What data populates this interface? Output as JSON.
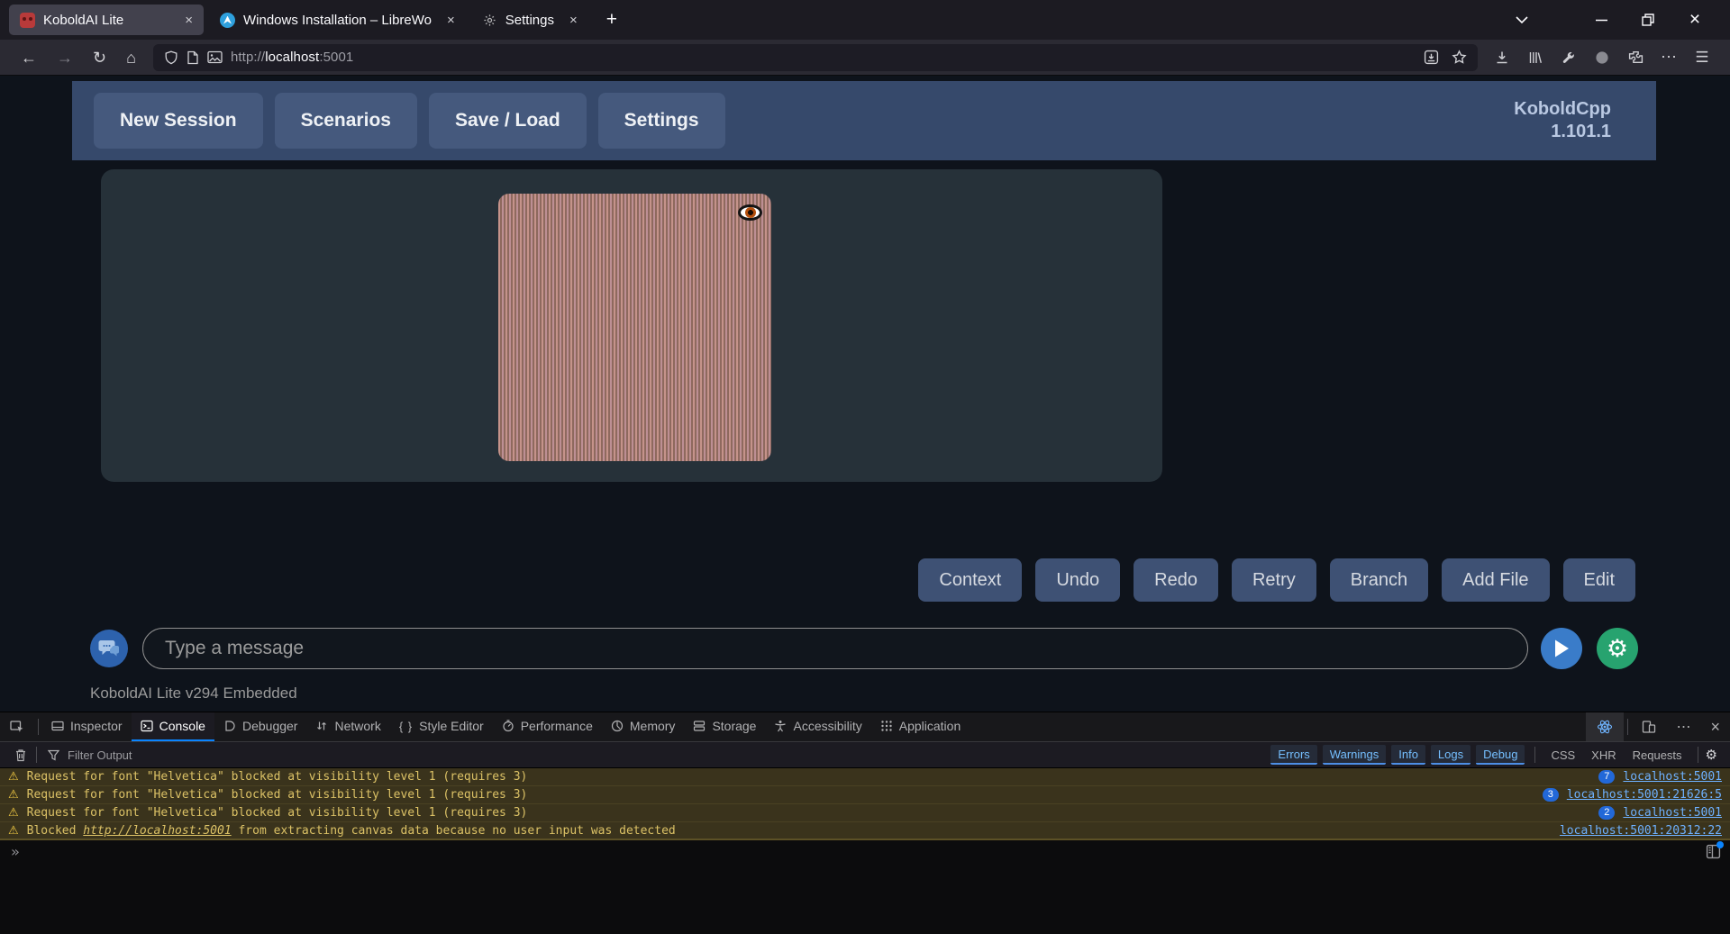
{
  "browser": {
    "tabs": [
      {
        "title": "KoboldAI Lite"
      },
      {
        "title": "Windows Installation – LibreWo"
      },
      {
        "title": "Settings"
      }
    ],
    "url": {
      "scheme": "http://",
      "host": "localhost",
      "port": ":5001"
    }
  },
  "app": {
    "nav": {
      "new_session": "New Session",
      "scenarios": "Scenarios",
      "save_load": "Save / Load",
      "settings": "Settings"
    },
    "brand": {
      "line1": "KoboldCpp",
      "line2": "1.101.1"
    },
    "actions": {
      "context": "Context",
      "undo": "Undo",
      "redo": "Redo",
      "retry": "Retry",
      "branch": "Branch",
      "add_file": "Add File",
      "edit": "Edit"
    },
    "chat": {
      "placeholder": "Type a message"
    },
    "footer": "KoboldAI Lite v294 Embedded"
  },
  "devtools": {
    "tabs": {
      "inspector": "Inspector",
      "console": "Console",
      "debugger": "Debugger",
      "network": "Network",
      "style_editor": "Style Editor",
      "performance": "Performance",
      "memory": "Memory",
      "storage": "Storage",
      "accessibility": "Accessibility",
      "application": "Application"
    },
    "active_tab": "Console",
    "filter": {
      "placeholder": "Filter Output",
      "errors": "Errors",
      "warnings": "Warnings",
      "info": "Info",
      "logs": "Logs",
      "debug": "Debug",
      "css": "CSS",
      "xhr": "XHR",
      "requests": "Requests"
    },
    "messages": [
      {
        "text": "Request for font \"Helvetica\" blocked at visibility level 1 (requires 3)",
        "count": "7",
        "source": "localhost:5001"
      },
      {
        "text": "Request for font \"Helvetica\" blocked at visibility level 1 (requires 3)",
        "count": "3",
        "source": "localhost:5001:21626:5"
      },
      {
        "text": "Request for font \"Helvetica\" blocked at visibility level 1 (requires 3)",
        "count": "2",
        "source": "localhost:5001"
      },
      {
        "pre": "Blocked ",
        "link": "http://localhost:5001",
        "post": " from extracting canvas data because no user input was detected",
        "source": "localhost:5001:20312:22"
      }
    ],
    "prompt": "»"
  },
  "icons": {
    "send": "play-triangle",
    "settings": "gear",
    "chat": "speech-bubbles",
    "image_hidden": "eye",
    "warning": "triangle-exclamation"
  },
  "colors": {
    "accent_blue": "#0a84ff",
    "link_blue": "#75bfff",
    "badge_blue": "#2268d8",
    "warning_bg": "#3a331c",
    "warning_text": "#dcc266",
    "header_navy": "#36496b",
    "button_navy": "#45597d",
    "send_blue": "#3a7cc9",
    "gear_green": "#27a36f",
    "image_salmon": "#c5938a"
  }
}
